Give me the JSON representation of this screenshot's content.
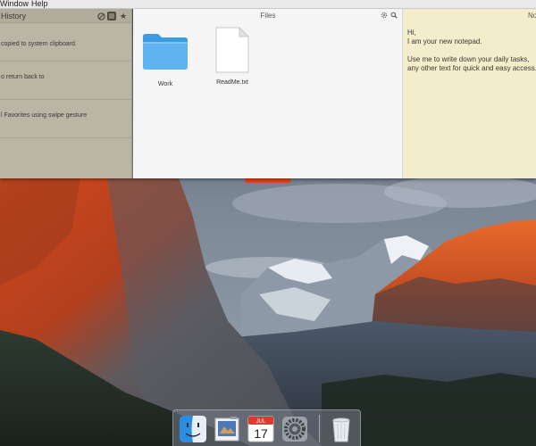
{
  "menubar": {
    "items": [
      "Window",
      "Help"
    ]
  },
  "history": {
    "title": "History",
    "items": [
      "copied to system clipboard.",
      "o return back to",
      "l Favorites using swipe gesture",
      ""
    ]
  },
  "files": {
    "title": "Files",
    "items": [
      {
        "name": "Work",
        "kind": "folder-icon"
      },
      {
        "name": "ReadMe.txt",
        "kind": "document-icon"
      }
    ]
  },
  "notes": {
    "title": "No",
    "lines": [
      "Hi,",
      "I am your new notepad.",
      "",
      "Use me to write down your daily tasks,",
      "any other text for quick and easy access."
    ]
  },
  "dock": {
    "items": [
      "finder-icon",
      "preview-icon",
      "calendar-icon",
      "system-preferences-icon",
      "trash-icon"
    ],
    "calendar": {
      "month": "JUL",
      "day": "17"
    }
  }
}
